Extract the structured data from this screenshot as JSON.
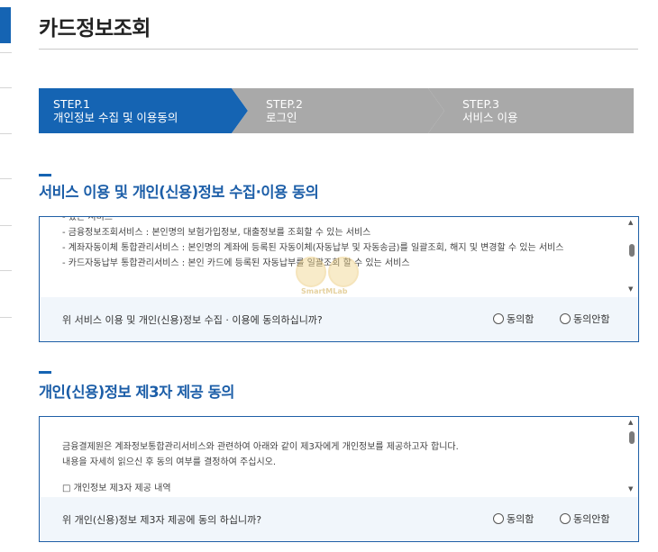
{
  "page": {
    "title": "카드정보조회"
  },
  "steps": [
    {
      "num": "STEP.1",
      "label": "개인정보 수집 및 이용동의",
      "active": true
    },
    {
      "num": "STEP.2",
      "label": "로그인",
      "active": false
    },
    {
      "num": "STEP.3",
      "label": "서비스 이용",
      "active": false
    }
  ],
  "section1": {
    "title": "서비스 이용 및 개인(신용)정보 수집·이용 동의",
    "list": [
      "- 있는 서비스",
      "- 금융정보조회서비스 : 본인명의 보험가입정보, 대출정보를 조회할 수 있는 서비스",
      "- 계좌자동이체 통합관리서비스 : 본인명의 계좌에 등록된 자동이체(자동납부 및 자동송금)를 일괄조회, 해지 및 변경할 수 있는 서비스",
      "- 카드자동납부 통합관리서비스 : 본인 카드에 등록된 자동납부를 일괄조회 할 수 있는 서비스"
    ],
    "question": "위 서비스 이용 및 개인(신용)정보 수집 · 이용에 동의하십니까?",
    "agree": "동의함",
    "disagree": "동의안함"
  },
  "section2": {
    "title": "개인(신용)정보 제3자 제공 동의",
    "line1": "금융결제원은 계좌정보통합관리서비스와 관련하여 아래와 같이 제3자에게 개인정보를 제공하고자 합니다.",
    "line2": "내용을 자세히 읽으신 후 동의 여부를 결정하여 주십시오.",
    "line3": "□ 개인정보 제3자 제공 내역",
    "question": "위 개인(신용)정보 제3자 제공에 동의 하십니까?",
    "agree": "동의함",
    "disagree": "동의안함"
  },
  "watermark": {
    "text": "SmartMLab"
  },
  "colors": {
    "accent": "#1564b3",
    "inactive_step": "#a9a9a9",
    "title_blue": "#1c5ea8"
  }
}
